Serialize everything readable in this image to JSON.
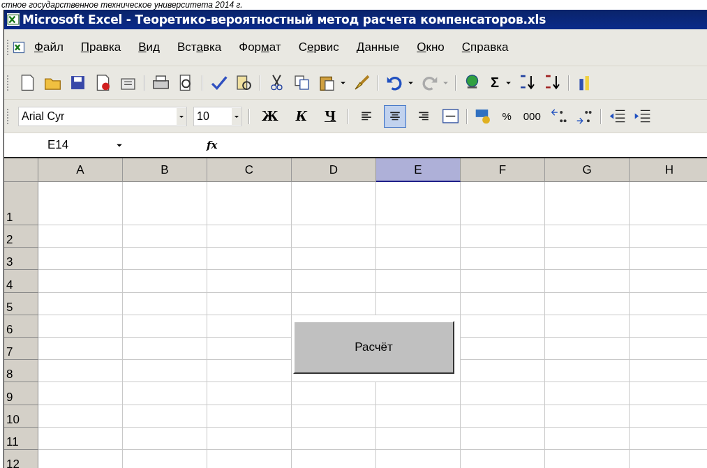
{
  "document_header": "стное государственное техническое университета 2014 г.",
  "window": {
    "title": "Microsoft Excel - Теоретико-вероятностный метод расчета компенсаторов.xls"
  },
  "menu": [
    {
      "key": "Ф",
      "post": "айл"
    },
    {
      "key": "П",
      "post": "равка"
    },
    {
      "key": "В",
      "post": "ид"
    },
    {
      "pre": "Вст",
      "key": "а",
      "post": "вка"
    },
    {
      "pre": "Фор",
      "key": "м",
      "post": "ат"
    },
    {
      "pre": "С",
      "key": "е",
      "post": "рвис"
    },
    {
      "key": "Д",
      "post": "анные"
    },
    {
      "key": "О",
      "post": "кно"
    },
    {
      "key": "С",
      "post": "правка"
    }
  ],
  "formatting": {
    "font": "Arial Cyr",
    "size": "10",
    "bold": "Ж",
    "italic": "К",
    "underline": "Ч",
    "align": [
      {
        "selected": false
      },
      {
        "selected": true
      },
      {
        "selected": false
      }
    ],
    "percent": "%",
    "thousands": "000",
    "sum": "Σ"
  },
  "name_box": "E14",
  "fx": "fx",
  "columns": [
    {
      "label": "A",
      "selected": false
    },
    {
      "label": "B",
      "selected": false
    },
    {
      "label": "C",
      "selected": false
    },
    {
      "label": "D",
      "selected": false
    },
    {
      "label": "E",
      "selected": true
    },
    {
      "label": "F",
      "selected": false
    },
    {
      "label": "G",
      "selected": false
    },
    {
      "label": "H",
      "selected": false
    }
  ],
  "rows": [
    "1",
    "2",
    "3",
    "4",
    "5",
    "6",
    "7",
    "8",
    "9",
    "10",
    "11",
    "12"
  ],
  "sheet_button": "Расчёт"
}
